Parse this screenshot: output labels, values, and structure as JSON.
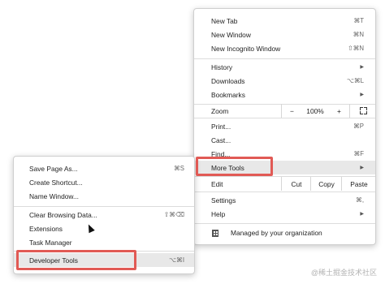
{
  "main_menu": {
    "items": [
      {
        "label": "New Tab",
        "shortcut": "⌘T"
      },
      {
        "label": "New Window",
        "shortcut": "⌘N"
      },
      {
        "label": "New Incognito Window",
        "shortcut": "⇧⌘N"
      },
      {
        "label": "History",
        "shortcut": "▶"
      },
      {
        "label": "Downloads",
        "shortcut": "⌥⌘L"
      },
      {
        "label": "Bookmarks",
        "shortcut": "▶"
      },
      {
        "label": "Print...",
        "shortcut": "⌘P"
      },
      {
        "label": "Cast...",
        "shortcut": ""
      },
      {
        "label": "Find...",
        "shortcut": "⌘F"
      },
      {
        "label": "More Tools",
        "shortcut": "▶"
      },
      {
        "label": "Settings",
        "shortcut": "⌘,"
      },
      {
        "label": "Help",
        "shortcut": "▶"
      }
    ],
    "zoom": {
      "label": "Zoom",
      "minus": "−",
      "value": "100%",
      "plus": "+"
    },
    "edit": {
      "label": "Edit",
      "cut": "Cut",
      "copy": "Copy",
      "paste": "Paste"
    },
    "managed": "Managed by your organization"
  },
  "sub_menu": {
    "items": [
      {
        "label": "Save Page As...",
        "shortcut": "⌘S"
      },
      {
        "label": "Create Shortcut...",
        "shortcut": ""
      },
      {
        "label": "Name Window...",
        "shortcut": ""
      },
      {
        "label": "Clear Browsing Data...",
        "shortcut": "⇧⌘⌫"
      },
      {
        "label": "Extensions",
        "shortcut": ""
      },
      {
        "label": "Task Manager",
        "shortcut": ""
      },
      {
        "label": "Developer Tools",
        "shortcut": "⌥⌘I"
      }
    ]
  },
  "watermark": "@稀土掘金技术社区",
  "colors": {
    "highlight_box": "#e15a55",
    "row_highlight": "#e8e8e8"
  }
}
